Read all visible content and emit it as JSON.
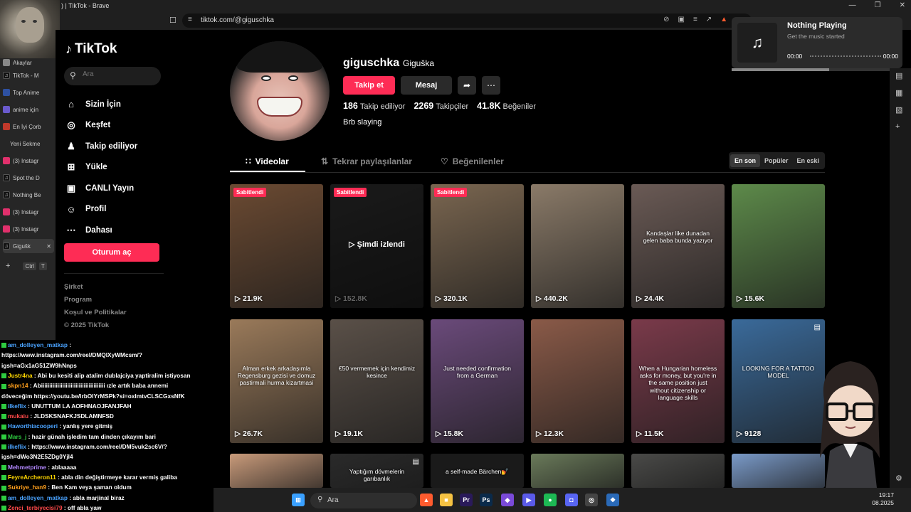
{
  "browser": {
    "title": ") | TikTok - Brave",
    "url": "tiktok.com/@giguschka",
    "window_controls": [
      "—",
      "❐",
      "✕"
    ]
  },
  "browser_tabs": [
    {
      "label": "Akaylar",
      "color": "#888888"
    },
    {
      "label": "TikTok - M",
      "color": "#111111"
    },
    {
      "label": "Top Anime",
      "color": "#2e51a2"
    },
    {
      "label": "anime için",
      "color": "#6a5acd"
    },
    {
      "label": "En İyi Çorb",
      "color": "#c0392b"
    },
    {
      "label": "Yeni Sekme",
      "color": ""
    },
    {
      "label": "(3) Instagr",
      "color": "#e1306c"
    },
    {
      "label": "Spot the D",
      "color": "#111111"
    },
    {
      "label": "Nothing Be",
      "color": "#111111"
    },
    {
      "label": "(3) Instagr",
      "color": "#e1306c"
    },
    {
      "label": "(3) Instagr",
      "color": "#e1306c"
    },
    {
      "label": "Gigušk",
      "color": "#111111"
    }
  ],
  "new_tab": {
    "plus": "+",
    "shortcut": "Ctrl",
    "key": "T"
  },
  "tiktok": {
    "logo": "TikTok",
    "search_placeholder": "Ara",
    "nav": [
      {
        "label": "Sizin İçin",
        "icon": "⌂"
      },
      {
        "label": "Keşfet",
        "icon": "◎"
      },
      {
        "label": "Takip ediliyor",
        "icon": "♟"
      },
      {
        "label": "Yükle",
        "icon": "⊞"
      },
      {
        "label": "CANLI Yayın",
        "icon": "▣"
      },
      {
        "label": "Profil",
        "icon": "☺"
      },
      {
        "label": "Dahası",
        "icon": "⋯"
      }
    ],
    "login": "Oturum aç",
    "footer": [
      "Şirket",
      "Program",
      "Koşul ve Politikalar",
      "© 2025 TikTok"
    ]
  },
  "profile": {
    "username": "giguschka",
    "nickname": "Giguška",
    "follow": "Takip et",
    "message": "Mesaj",
    "stats": [
      {
        "value": "186",
        "label": "Takip ediliyor"
      },
      {
        "value": "2269",
        "label": "Takipçiler"
      },
      {
        "value": "41.8K",
        "label": "Beğeniler"
      }
    ],
    "bio": "Brb slaying"
  },
  "profile_tabs": [
    {
      "label": "Videolar",
      "icon": "∷"
    },
    {
      "label": "Tekrar paylaşılanlar",
      "icon": "⇅"
    },
    {
      "label": "Beğenilenler",
      "icon": "♡"
    }
  ],
  "sort": [
    "En son",
    "Popüler",
    "En eski"
  ],
  "pinned_label": "Sabitlendi",
  "watched_label": "Şimdi izlendi",
  "videos": [
    {
      "views": "21.9K",
      "pinned": true,
      "bg": "#6b4a32",
      "caption": ""
    },
    {
      "views": "152.8K",
      "pinned": true,
      "bg": "#3a3a3a",
      "caption": "",
      "watched": true
    },
    {
      "views": "320.1K",
      "pinned": true,
      "bg": "#7a6650",
      "caption": ""
    },
    {
      "views": "440.2K",
      "pinned": false,
      "bg": "#8a7a68",
      "caption": ""
    },
    {
      "views": "24.4K",
      "pinned": false,
      "bg": "#6a5a55",
      "caption": "Kandaşlar like dunadan gelen baba bunda yazıyor"
    },
    {
      "views": "15.6K",
      "pinned": false,
      "bg": "#5d8a4a",
      "caption": ""
    },
    {
      "views": "26.7K",
      "pinned": false,
      "bg": "#9a7a5a",
      "caption": "Alman erkek arkadaşımla Regensburg gezisi ve domuz pastirmali hurma kizartmasi"
    },
    {
      "views": "19.1K",
      "pinned": false,
      "bg": "#5a5048",
      "caption": "€50 vermemek için kendimiz kesince"
    },
    {
      "views": "15.8K",
      "pinned": false,
      "bg": "#6a4a7a",
      "caption": "Just needed confirmation from a German"
    },
    {
      "views": "12.3K",
      "pinned": false,
      "bg": "#8a5a48",
      "caption": ""
    },
    {
      "views": "11.5K",
      "pinned": false,
      "bg": "#7a3a4a",
      "caption": "When a Hungarian homeless asks for money, but you're in the same position just without citizenship or language skills"
    },
    {
      "views": "9128",
      "pinned": false,
      "bg": "#3a6a9a",
      "caption": "LOOKING FOR A TATTOO MODEL",
      "photo": true
    },
    {
      "views": "",
      "pinned": false,
      "bg": "#c89a7a",
      "caption": ""
    },
    {
      "views": "",
      "pinned": false,
      "bg": "#2a2a2a",
      "caption": "Yaptığım dövmelerin garıbanlık",
      "photo": true
    },
    {
      "views": "",
      "pinned": false,
      "bg": "#1a1a1a",
      "caption": "a self-made Bärchen💅"
    },
    {
      "views": "",
      "pinned": false,
      "bg": "#6a7a5a",
      "caption": ""
    },
    {
      "views": "",
      "pinned": false,
      "bg": "#4a4a48",
      "caption": ""
    },
    {
      "views": "",
      "pinned": false,
      "bg": "#7a9ac8",
      "caption": ""
    }
  ],
  "chat": [
    {
      "user": "am_dolleyen_matkap",
      "color": "#4aa3ff",
      "text": " :"
    },
    {
      "user": "",
      "color": "#ffffff",
      "text": "https://www.instagram.com/reel/DMQlXyWMcsm/?"
    },
    {
      "user": "",
      "color": "#ffffff",
      "text": "igsh=aGx1aG51ZW9hNnps"
    },
    {
      "user": "Justr4na",
      "color": "#ffd700",
      "text": " : Abi bu kesiti alip atalim dublajciya yaptiralim istiyosan"
    },
    {
      "user": "skpn14",
      "color": "#ff9f1c",
      "text": " : Abiiiiiiiiiiiiiiiiiiiiiiiiiiiiiiiiiiiiiii ızle artık baba annemi"
    },
    {
      "user": "",
      "color": "#ffffff",
      "text": "döveceğim https://youtu.be/lrbOIYrMSPk?si=oxImtvCLSCGxsNfK"
    },
    {
      "user": "ilkeflix",
      "color": "#4aa3ff",
      "text": " : UNUTTUM LA AOFHNAOJFANJFAH"
    },
    {
      "user": "mukaiu",
      "color": "#ff4a4a",
      "text": " : JLDSKSNAFKJSDLAMNFSD"
    },
    {
      "user": "Haworthiacooperi",
      "color": "#4aa3ff",
      "text": " : yanlış yere gitmiş"
    },
    {
      "user": "Mars_j",
      "color": "#2ecc40",
      "text": " : hazir günah işledim tam dinden çıkayım bari"
    },
    {
      "user": "ilkeflix",
      "color": "#4aa3ff",
      "text": " : https://www.instagram.com/reel/DM5vuk2sc6V/?"
    },
    {
      "user": "",
      "color": "#ffffff",
      "text": "igsh=dWo3N2E5ZDg0YjI4"
    },
    {
      "user": "Mehmetprime",
      "color": "#b388ff",
      "text": " : ablaaaaa"
    },
    {
      "user": "FeyreArcheron11",
      "color": "#ffd700",
      "text": " : abla din değiştirmeye karar vermiş galiba"
    },
    {
      "user": "Sukriye_han9",
      "color": "#ff9f1c",
      "text": " : Ben Kam veya şaman oldum"
    },
    {
      "user": "am_dolleyen_matkap",
      "color": "#4aa3ff",
      "text": " : abla marjinal biraz"
    },
    {
      "user": "Zenci_terbiyecisi79",
      "color": "#ff4a4a",
      "text": " : off abla yaw"
    }
  ],
  "music": {
    "title": "Nothing Playing",
    "subtitle": "Get the music started",
    "time_start": "00:00",
    "time_end": "00:00",
    "progress": 0.57
  },
  "taskbar": {
    "search_placeholder": "Ara",
    "time": "19:17",
    "date": "08.2025",
    "apps": [
      {
        "name": "windows-start-icon",
        "label": "⊞",
        "color": "#3aa0ff"
      },
      {
        "name": "brave-icon",
        "label": "▲",
        "color": "#ff5b2e"
      },
      {
        "name": "file-explorer-icon",
        "label": "■",
        "color": "#f5c242"
      },
      {
        "name": "premiere-icon",
        "label": "Pr",
        "color": "#2a1a5a"
      },
      {
        "name": "photoshop-icon",
        "label": "Ps",
        "color": "#0a2a4a"
      },
      {
        "name": "obsidian-icon",
        "label": "◆",
        "color": "#7a4ad8"
      },
      {
        "name": "arrow-app-icon",
        "label": "▶",
        "color": "#5a5ae8"
      },
      {
        "name": "spotify-icon",
        "label": "●",
        "color": "#1db954"
      },
      {
        "name": "discord-icon",
        "label": "◘",
        "color": "#5865f2"
      },
      {
        "name": "obs-icon",
        "label": "◎",
        "color": "#444444"
      },
      {
        "name": "vscode-icon",
        "label": "❖",
        "color": "#2a6ab8"
      }
    ]
  }
}
